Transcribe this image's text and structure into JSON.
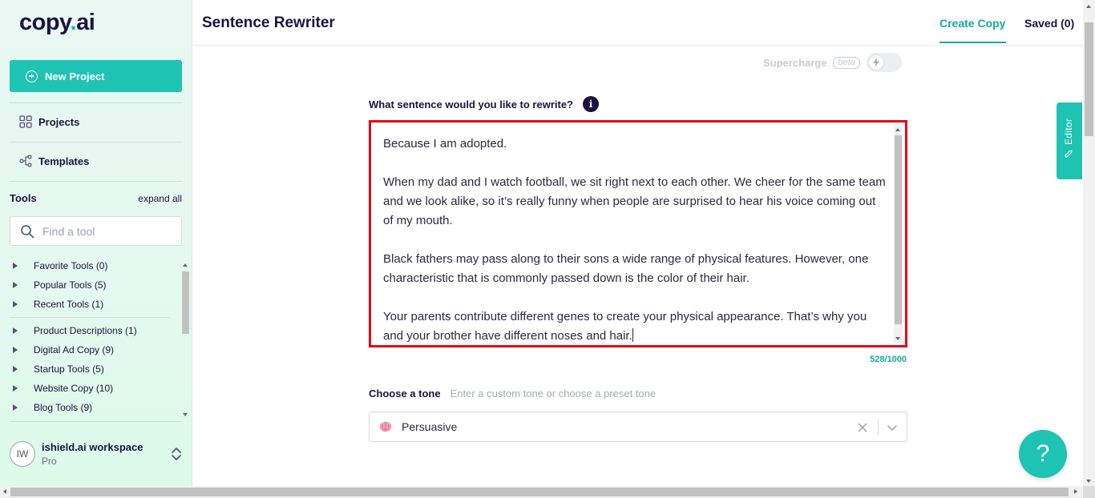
{
  "brand": {
    "name_part1": "copy",
    "name_dot": ".",
    "name_part2": "ai",
    "accent": "#1ec3b3",
    "dark": "#1c1240"
  },
  "sidebar": {
    "new_project_label": "New Project",
    "nav": [
      {
        "label": "Projects",
        "icon": "grid-icon"
      },
      {
        "label": "Templates",
        "icon": "share-nodes-icon"
      }
    ],
    "tools_title": "Tools",
    "expand_all": "expand all",
    "search_placeholder": "Find a tool",
    "tool_groups": [
      {
        "label": "Favorite Tools (0)"
      },
      {
        "label": "Popular Tools (5)"
      },
      {
        "label": "Recent Tools (1)"
      },
      {
        "label": "Product Descriptions (1)"
      },
      {
        "label": "Digital Ad Copy (9)"
      },
      {
        "label": "Startup Tools (5)"
      },
      {
        "label": "Website Copy (10)"
      },
      {
        "label": "Blog Tools (9)"
      }
    ],
    "workspace": {
      "initials": "IW",
      "name": "ishield.ai workspace",
      "plan": "Pro"
    }
  },
  "header": {
    "title": "Sentence Rewriter",
    "tabs": [
      {
        "label": "Create Copy",
        "active": true
      },
      {
        "label": "Saved (0)",
        "active": false
      }
    ]
  },
  "main": {
    "supercharge_label": "Supercharge",
    "supercharge_badge": "beta",
    "supercharge_on": false,
    "question": "What sentence would you like to rewrite?",
    "info_glyph": "i",
    "input_text": "Because I am adopted.\n\nWhen my dad and I watch football, we sit right next to each other. We cheer for the same team and we look alike, so it’s really funny when people are surprised to hear his voice coming out of my mouth.\n\nBlack fathers may pass along to their sons a wide range of physical features. However, one characteristic that is commonly passed down is the color of their hair.\n\nYour parents contribute different genes to create your physical appearance. That’s why you and your brother have different noses and hair.",
    "char_count": "528/1000",
    "tone_label": "Choose a tone",
    "tone_hint": "Enter a custom tone or choose a preset tone",
    "tone_value": "Persuasive",
    "tone_icon": "brain-emoji"
  },
  "editor_tab_label": "Editor",
  "help_label": "?"
}
